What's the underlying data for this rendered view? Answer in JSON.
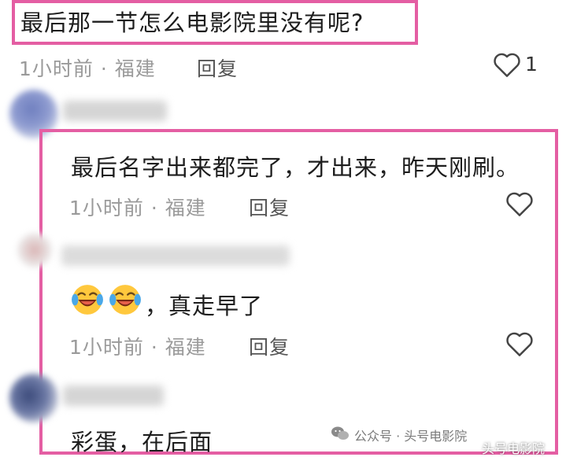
{
  "top_comment": {
    "text": "最后那一节怎么电影院里没有呢?",
    "time_location": "1小时前 · 福建",
    "reply_label": "回复",
    "like_count": "1"
  },
  "replies": [
    {
      "text": "最后名字出来都完了，才出来，昨天刚刷。",
      "time_location": "1小时前 · 福建",
      "reply_label": "回复"
    },
    {
      "text": "，真走早了",
      "time_location": "1小时前 · 福建",
      "reply_label": "回复"
    },
    {
      "text": "彩蛋，在后面"
    }
  ],
  "watermark": {
    "text": "公众号 · 头号电影院",
    "text_overlay": "头号电影院"
  },
  "colors": {
    "highlight": "#e45ea3",
    "meta": "#9a9a9a"
  }
}
